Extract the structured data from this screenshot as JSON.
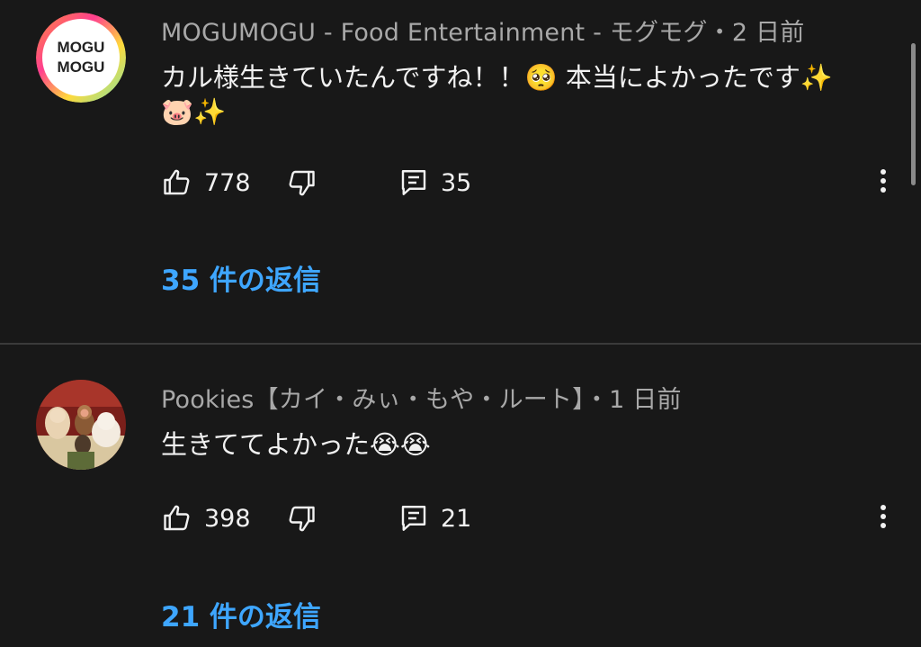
{
  "comments": [
    {
      "author": "MOGUMOGU - Food Entertainment - モグモグ",
      "time_separator": "・",
      "time": "2 日前",
      "avatar_text": [
        "MOGU",
        "MOGU"
      ],
      "text": "カル様生きていたんですね！！🥺 本当によかったです✨\n🐷✨",
      "likes": "778",
      "replies_count": "35",
      "replies_link": "35 件の返信"
    },
    {
      "author": "Pookies【カイ・みぃ・もや・ルート】",
      "time_separator": "・",
      "time": "1 日前",
      "text": "生きててよかった😭😭",
      "likes": "398",
      "replies_count": "21",
      "replies_link": "21 件の返信"
    }
  ],
  "colors": {
    "background": "#181818",
    "text": "#f1f1f1",
    "secondary_text": "#a8a8a8",
    "link": "#3ea6ff"
  },
  "icons": {
    "like": "thumbs-up-icon",
    "dislike": "thumbs-down-icon",
    "reply": "comment-icon",
    "more": "more-vert-icon"
  }
}
